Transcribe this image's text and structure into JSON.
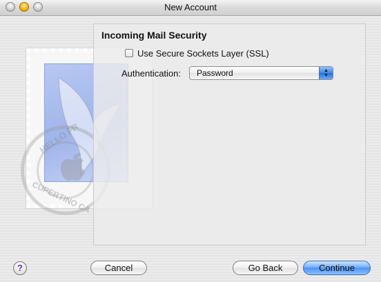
{
  "window": {
    "title": "New Account"
  },
  "security": {
    "section_title": "Incoming Mail Security",
    "ssl_label": "Use Secure Sockets Layer (SSL)",
    "ssl_checked": false,
    "auth_label": "Authentication:",
    "auth_value": "Password"
  },
  "decoration": {
    "postmark_top": "HELLO FR",
    "postmark_bottom": "CUPERTINO CA"
  },
  "buttons": {
    "help_glyph": "?",
    "cancel": "Cancel",
    "go_back": "Go Back",
    "continue": "Continue"
  },
  "colors": {
    "accent": "#4b93f5",
    "window_bg": "#ececec"
  }
}
